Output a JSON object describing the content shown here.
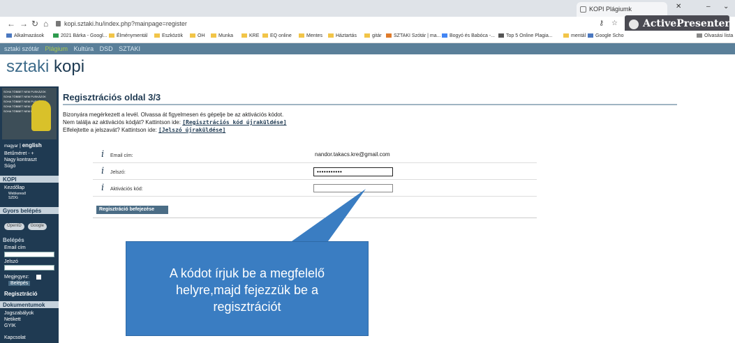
{
  "browser": {
    "tab_title": "KOPI Plágiumk",
    "url": "kopi.sztaki.hu/index.php?mainpage=register",
    "recorder_badge": "ActivePresenter",
    "bookmarks": [
      "Alkalmazások",
      "2021 Bárka - Googl...",
      "Élménymentál",
      "Eszközök",
      "OH",
      "Munka",
      "KRE",
      "EQ online",
      "Mentes",
      "Háztartás",
      "gitár",
      "SZTAKI Szótár | ma...",
      "Bogyó és Babóca -...",
      "Top 5 Online Plagia...",
      "mentál",
      "Google Scho"
    ],
    "reading_list": "Olvasási lista"
  },
  "site": {
    "topnav": [
      "sztaki szótár",
      "Plágium",
      "Kultúra",
      "DSD",
      "SZTAKI"
    ],
    "logo_light": "sztaki",
    "logo_bold": "kopi"
  },
  "sidebar": {
    "image_lines": [
      "SOHA TÖBBET NEM PUSKÁZOK",
      "SOHA TÖBBET NEM PUSKÁZOK",
      "SOHA TÖBBET NEM PUSKÁZOK",
      "SOHA TÖBBET NEM PU",
      "SOHA TÖBBET NEM PU"
    ],
    "lang_hu": "magyar",
    "lang_en": "english",
    "font_size": "Betűméret - +",
    "high_contrast": "Nagy kontraszt",
    "help": "Súgó",
    "kopi_head": "KOPI",
    "home": "Kezdőlap",
    "webkereso": "Webkereső",
    "szdg": "SZDG",
    "quick_login_head": "Gyors belépés",
    "openid": "OpenID",
    "google": "Google",
    "login_head": "Belépés",
    "email_label": "Email cím",
    "password_label": "Jelszó",
    "remember_label": "Megjegyez:",
    "login_button": "Belépés",
    "register": "Regisztráció",
    "documents_head": "Dokumentumok",
    "rules": "Jogszabályok",
    "netiquette": "Netikett",
    "faq": "GYIK",
    "contact": "Kapcsolat"
  },
  "main": {
    "title": "Regisztrációs oldal 3/3",
    "intro_line1": "Bizonyára megérkezett a levél. Olvassa át figyelmesen és gépelje be az aktivációs kódot.",
    "intro_line2": "Nem találja az aktivációs kódját? Kattintson ide:",
    "resend_code_link": "[Regisztrációs kód újraküldése]",
    "intro_line3": "Elfelejtette a jelszavát? Kattintson ide:",
    "resend_password_link": "[Jelszó újraküldése]",
    "info_icon": "i",
    "email_label": "Email cím:",
    "email_value": "nandor.takacs.kre@gmail.com",
    "password_label": "Jelszó:",
    "password_value": "•••••••••••",
    "activation_label": "Aktivációs kód:",
    "activation_value": "",
    "submit_label": "Regisztráció befejezése"
  },
  "callout": {
    "text": "A kódot írjuk be a megfelelő helyre,majd fejezzük be a regisztrációt"
  },
  "colors": {
    "sitebar": "#5a7f99",
    "sidebar": "#1f3a52",
    "callout": "#3a7dc2",
    "accent_green": "#a9c84e"
  }
}
